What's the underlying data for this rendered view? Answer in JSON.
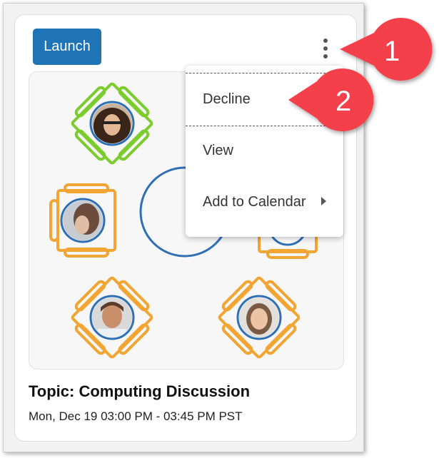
{
  "card": {
    "launch_label": "Launch",
    "topic": "Topic: Computing Discussion",
    "time": "Mon, Dec 19 03:00 PM - 03:45 PM PST"
  },
  "menu": {
    "items": [
      {
        "label": "Decline"
      },
      {
        "label": "View"
      },
      {
        "label": "Add to Calendar"
      }
    ]
  },
  "callouts": [
    "1",
    "2"
  ],
  "colors": {
    "launch_bg": "#1f73b7",
    "table_green": "#7ccc2e",
    "table_orange": "#f2a533",
    "round_table": "#2f6fb5",
    "callout_red": "#f4414b"
  }
}
